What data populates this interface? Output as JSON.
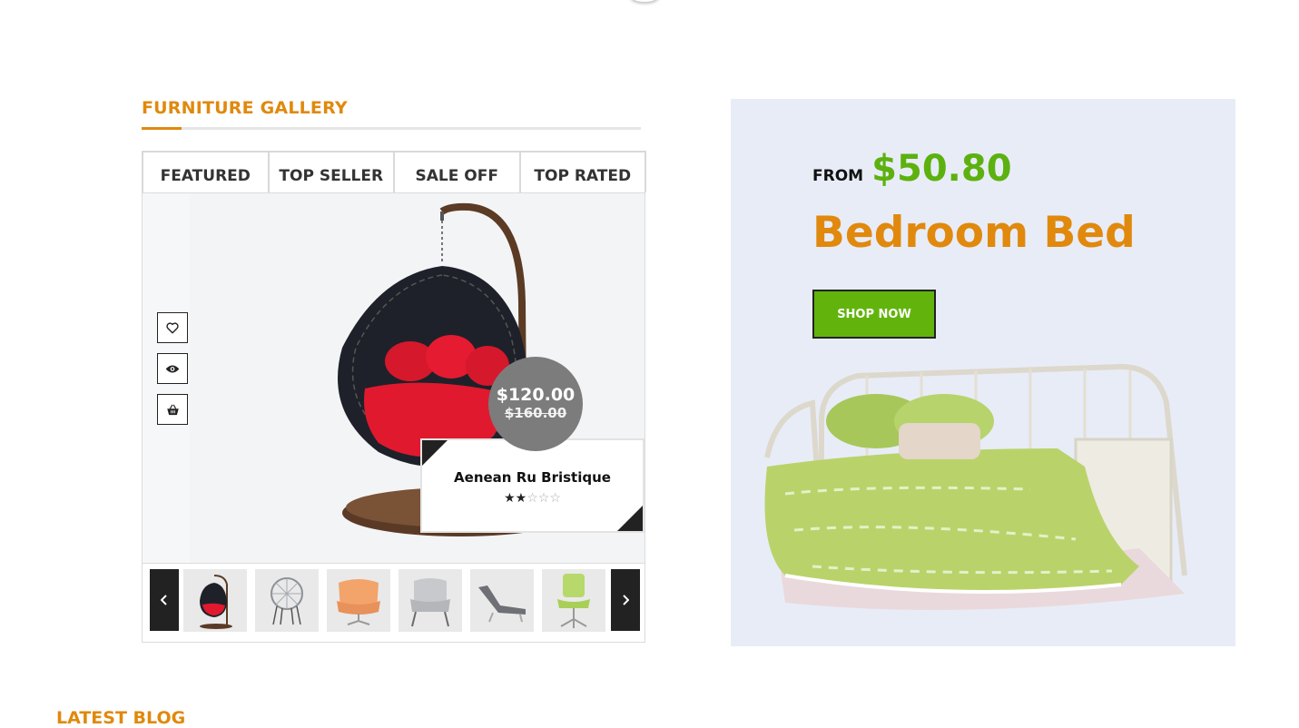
{
  "gallery": {
    "title": "FURNITURE GALLERY",
    "tabs": [
      "FEATURED",
      "TOP SELLER",
      "SALE OFF",
      "TOP RATED"
    ],
    "product": {
      "name": "Aenean Ru Bristique",
      "price": "$120.00",
      "old_price": "$160.00",
      "rating": 2,
      "rating_max": 5
    },
    "actions": [
      "heart-icon",
      "eye-icon",
      "basket-icon"
    ],
    "thumbnails": [
      "hanging-egg-chair",
      "wire-round-chair",
      "orange-lounge-chair",
      "grey-armchair",
      "grey-chaise-lounge",
      "green-office-chair"
    ]
  },
  "banner": {
    "from_label": "FROM",
    "price": "$50.80",
    "title": "Bedroom Bed",
    "button_label": "SHOP NOW"
  },
  "next_section": {
    "title": "LATEST BLOG"
  },
  "colors": {
    "accent_orange": "#e0890d",
    "accent_green": "#62b40c",
    "banner_bg": "#e8ecf7",
    "dark": "#222222"
  }
}
